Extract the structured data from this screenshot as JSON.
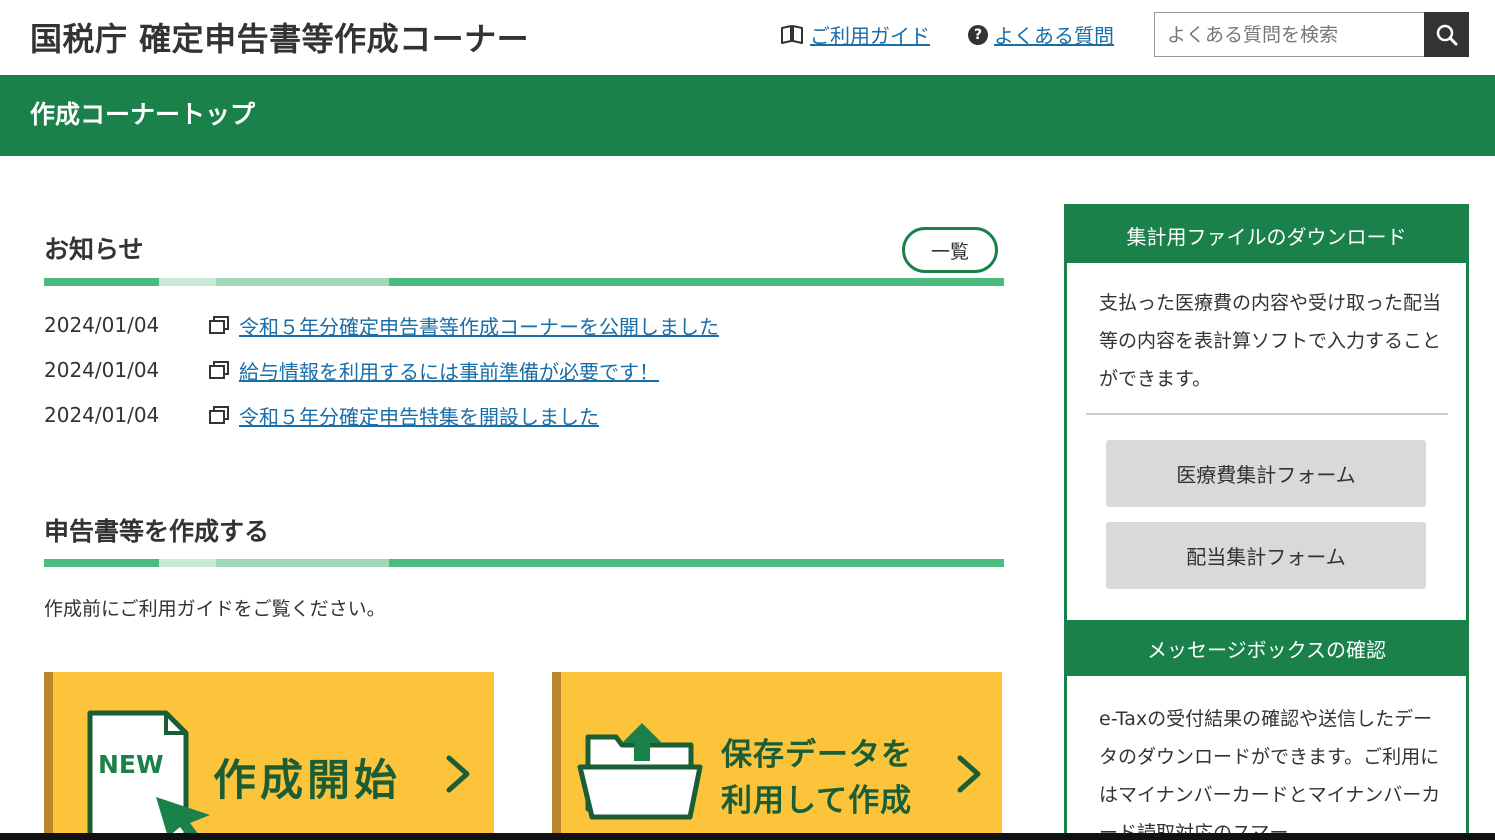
{
  "header": {
    "site_title": "国税庁 確定申告書等作成コーナー",
    "guide_link": "ご利用ガイド",
    "faq_link": "よくある質問",
    "search_placeholder": "よくある質問を検索"
  },
  "nav": {
    "title": "作成コーナートップ"
  },
  "news": {
    "title": "お知らせ",
    "list_button": "一覧",
    "items": [
      {
        "date": "2024/01/04",
        "text": "令和５年分確定申告書等作成コーナーを公開しました"
      },
      {
        "date": "2024/01/04",
        "text": "給与情報を利用するには事前準備が必要です！"
      },
      {
        "date": "2024/01/04",
        "text": "令和５年分確定申告特集を開設しました"
      }
    ]
  },
  "create": {
    "title": "申告書等を作成する",
    "guide_text": "作成前にご利用ガイドをご覧ください。",
    "new_badge": "NEW",
    "start_label": "作成開始",
    "saved_label_line1": "保存データを",
    "saved_label_line2": "利用して作成"
  },
  "sidebar": {
    "download": {
      "title": "集計用ファイルのダウンロード",
      "description": "支払った医療費の内容や受け取った配当等の内容を表計算ソフトで入力することができます。",
      "medical_button": "医療費集計フォーム",
      "dividend_button": "配当集計フォーム"
    },
    "messagebox": {
      "title": "メッセージボックスの確認",
      "description": "e-Taxの受付結果の確認や送信したデータのダウンロードができます。ご利用にはマイナンバーカードとマイナンバーカード読取対応のスマー"
    }
  },
  "colors": {
    "brand_green": "#1b814b",
    "accent_green": "#4cbb7f",
    "card_yellow": "#fcc43b",
    "link_blue": "#1a6ea8"
  }
}
